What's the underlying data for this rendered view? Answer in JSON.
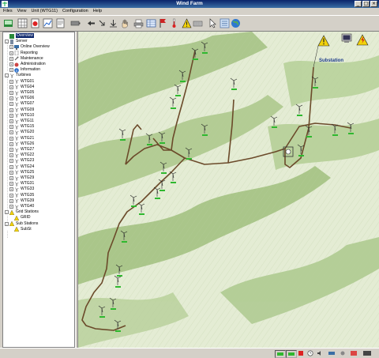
{
  "window": {
    "title": "Wind Farm",
    "controls": [
      "_",
      "□",
      "×"
    ]
  },
  "menu": [
    {
      "label": "Files"
    },
    {
      "label": "View"
    },
    {
      "label": "Unit (WTG11)"
    },
    {
      "label": "Configuration"
    },
    {
      "label": "Help"
    }
  ],
  "toolbar": {
    "buttons": [
      "overview-icon",
      "grid-icon",
      "alarm-list-icon",
      "trend-chart-icon",
      "report-icon",
      "battery-icon",
      "arrow-left-icon",
      "arrow-down-right-icon",
      "arrow-down-icon",
      "hand-icon",
      "print-icon",
      "spreadsheet-icon",
      "flag-icon",
      "thermometer-icon",
      "warning-icon",
      "keyboard-icon",
      "pointer-icon",
      "list-icon",
      "globe-icon"
    ]
  },
  "tree": {
    "items": [
      {
        "label": "Overview",
        "level": 0,
        "selected": true,
        "icon": "overview-icon"
      },
      {
        "label": "Server",
        "level": 0,
        "expander": "-",
        "icon": "server-icon"
      },
      {
        "label": "Online Overview",
        "level": 1,
        "expander": "+",
        "icon": "monitor-icon"
      },
      {
        "label": "Reporting",
        "level": 1,
        "expander": "+",
        "icon": "report-icon"
      },
      {
        "label": "Maintenance",
        "level": 1,
        "expander": "+",
        "icon": "wrench-icon"
      },
      {
        "label": "Administration",
        "level": 1,
        "expander": "+",
        "icon": "admin-icon"
      },
      {
        "label": "Information",
        "level": 1,
        "expander": "+",
        "icon": "info-icon"
      },
      {
        "label": "Turbines",
        "level": 0,
        "expander": "-",
        "icon": "turbine-icon"
      },
      {
        "label": "WTG01",
        "level": 1,
        "expander": "+",
        "icon": "turbine-icon"
      },
      {
        "label": "WTG04",
        "level": 1,
        "expander": "+",
        "icon": "turbine-icon"
      },
      {
        "label": "WTG05",
        "level": 1,
        "expander": "+",
        "icon": "turbine-icon"
      },
      {
        "label": "WTG06",
        "level": 1,
        "expander": "+",
        "icon": "turbine-icon"
      },
      {
        "label": "WTG07",
        "level": 1,
        "expander": "+",
        "icon": "turbine-icon"
      },
      {
        "label": "WTG09",
        "level": 1,
        "expander": "+",
        "icon": "turbine-icon"
      },
      {
        "label": "WTG10",
        "level": 1,
        "expander": "+",
        "icon": "turbine-icon"
      },
      {
        "label": "WTG11",
        "level": 1,
        "expander": "+",
        "icon": "turbine-icon"
      },
      {
        "label": "WTG15",
        "level": 1,
        "expander": "+",
        "icon": "turbine-icon"
      },
      {
        "label": "WTG20",
        "level": 1,
        "expander": "+",
        "icon": "turbine-icon"
      },
      {
        "label": "WTG21",
        "level": 1,
        "expander": "+",
        "icon": "turbine-icon"
      },
      {
        "label": "WTG26",
        "level": 1,
        "expander": "+",
        "icon": "turbine-icon"
      },
      {
        "label": "WTG27",
        "level": 1,
        "expander": "+",
        "icon": "turbine-icon"
      },
      {
        "label": "WTG22",
        "level": 1,
        "expander": "+",
        "icon": "turbine-icon"
      },
      {
        "label": "WTG23",
        "level": 1,
        "expander": "+",
        "icon": "turbine-icon"
      },
      {
        "label": "WTG24",
        "level": 1,
        "expander": "+",
        "icon": "turbine-icon"
      },
      {
        "label": "WTG25",
        "level": 1,
        "expander": "+",
        "icon": "turbine-icon"
      },
      {
        "label": "WTG29",
        "level": 1,
        "expander": "+",
        "icon": "turbine-icon"
      },
      {
        "label": "WTG31",
        "level": 1,
        "expander": "+",
        "icon": "turbine-icon"
      },
      {
        "label": "WTG33",
        "level": 1,
        "expander": "+",
        "icon": "turbine-icon"
      },
      {
        "label": "WTG35",
        "level": 1,
        "expander": "+",
        "icon": "turbine-icon"
      },
      {
        "label": "WTG39",
        "level": 1,
        "expander": "+",
        "icon": "turbine-icon"
      },
      {
        "label": "WTG40",
        "level": 1,
        "expander": "+",
        "icon": "turbine-icon"
      },
      {
        "label": "Grid Stations",
        "level": 0,
        "expander": "-",
        "icon": "warning-icon"
      },
      {
        "label": "GRID",
        "level": 1,
        "icon": "warning-icon"
      },
      {
        "label": "Sub Stations",
        "level": 0,
        "expander": "-",
        "icon": "warning-icon"
      },
      {
        "label": "SubSt",
        "level": 1,
        "icon": "warning-icon"
      }
    ]
  },
  "map": {
    "substation_label": "Substation",
    "turbine_count": 30
  },
  "status": {
    "icons": [
      "status-field-icon",
      "status-field-icon",
      "alarm-icon",
      "clock-icon",
      "speaker-icon",
      "network-icon",
      "settings-icon",
      "comm-icon",
      "exit-icon"
    ]
  },
  "colors": {
    "titlebar": "#0a246a",
    "road": "#6b4a2a",
    "terrain": "#dfe9cc",
    "ok_bar": "#2fb82f",
    "warning": "#f2d20a"
  }
}
